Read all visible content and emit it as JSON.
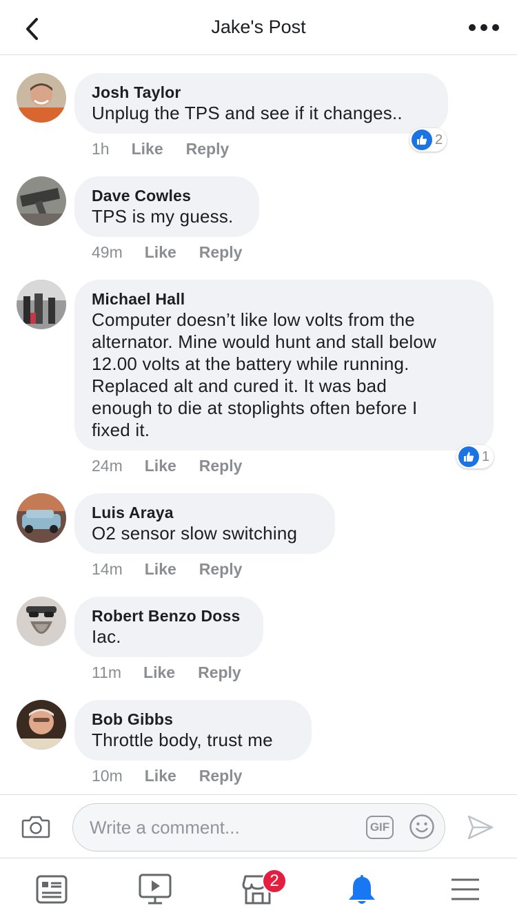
{
  "header": {
    "title": "Jake's Post",
    "back_icon": "chevron-left-icon",
    "more_icon": "more-horizontal-icon"
  },
  "comments": [
    {
      "author": "Josh Taylor",
      "lines": [
        "Unplug the TPS and see if it changes.."
      ],
      "time": "1h",
      "like_label": "Like",
      "reply_label": "Reply",
      "reaction_count": "2",
      "avatar_icon": "avatar-photo"
    },
    {
      "author": "Dave Cowles",
      "lines": [
        "TPS is my guess."
      ],
      "time": "49m",
      "like_label": "Like",
      "reply_label": "Reply",
      "avatar_icon": "avatar-photo"
    },
    {
      "author": "Michael Hall",
      "lines": [
        "Computer doesn’t like low volts from the",
        "alternator.  Mine would hunt and stall below",
        "12.00 volts at the battery while running.",
        "Replaced alt and cured it. It was bad",
        "enough to die at stoplights often before I",
        "fixed it."
      ],
      "time": "24m",
      "like_label": "Like",
      "reply_label": "Reply",
      "reaction_count": "1",
      "avatar_icon": "avatar-photo"
    },
    {
      "author": "Luis Araya",
      "lines": [
        "O2 sensor slow switching"
      ],
      "time": "14m",
      "like_label": "Like",
      "reply_label": "Reply",
      "avatar_icon": "avatar-photo"
    },
    {
      "author": "Robert Benzo Doss",
      "lines": [
        "Iac."
      ],
      "time": "11m",
      "like_label": "Like",
      "reply_label": "Reply",
      "avatar_icon": "avatar-photo"
    },
    {
      "author": "Bob Gibbs",
      "lines": [
        "Throttle body, trust me"
      ],
      "time": "10m",
      "like_label": "Like",
      "reply_label": "Reply",
      "avatar_icon": "avatar-photo"
    }
  ],
  "composer": {
    "placeholder": "Write a comment...",
    "gif_label": "GIF",
    "camera_icon": "camera-icon",
    "emoji_icon": "smiley-icon",
    "send_icon": "send-icon"
  },
  "tabbar": {
    "tabs": [
      "news-feed-icon",
      "watch-icon",
      "marketplace-icon",
      "notifications-icon",
      "menu-icon"
    ],
    "marketplace_badge": "2",
    "active_color": "#1877f2",
    "inactive_color": "#65676b"
  },
  "colors": {
    "like_blue": "#1b74e4",
    "bubble_bg": "#f0f2f5",
    "badge_red": "#e41e3f"
  }
}
